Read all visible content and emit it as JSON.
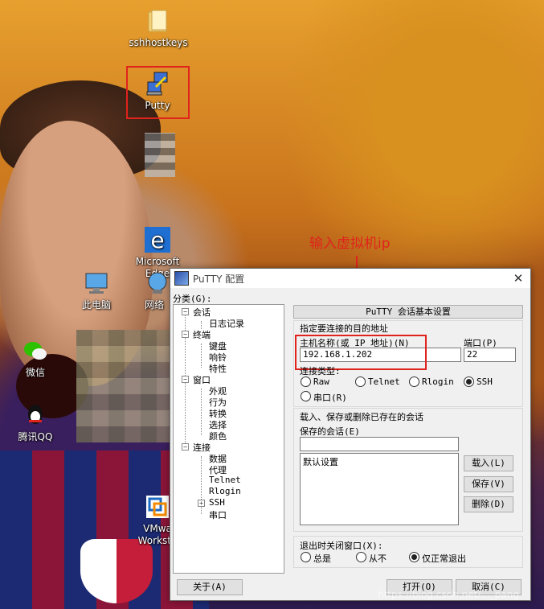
{
  "desktop": {
    "icons": [
      {
        "label": "sshhostkeys",
        "icon": "folder-icon"
      },
      {
        "label": "Putty",
        "icon": "putty-icon"
      },
      {
        "label": "Microsoft\nEdge",
        "icon": "edge-icon"
      },
      {
        "label": "此电脑",
        "icon": "computer-icon"
      },
      {
        "label": "网络",
        "icon": "network-icon"
      },
      {
        "label": "微信",
        "icon": "wechat-icon"
      },
      {
        "label": "腾讯QQ",
        "icon": "qq-icon"
      },
      {
        "label": "VMwa\nWorksta",
        "icon": "vmware-icon"
      }
    ],
    "annotation": "输入虚拟机ip",
    "watermark": "https://blog.csdn.net/..._pang"
  },
  "dialog": {
    "title": "PuTTY 配置",
    "close_glyph": "✕",
    "category_label": "分类(G):",
    "tree": {
      "session": "会话",
      "logging": "日志记录",
      "terminal": "终端",
      "keyboard": "键盘",
      "bell": "响铃",
      "features": "特性",
      "window": "窗口",
      "appearance": "外观",
      "behaviour": "行为",
      "translation": "转换",
      "selection": "选择",
      "colours": "颜色",
      "connection": "连接",
      "data": "数据",
      "proxy": "代理",
      "telnet": "Telnet",
      "rlogin": "Rlogin",
      "ssh": "SSH",
      "serial": "串口"
    },
    "header_button": "PuTTY 会话基本设置",
    "target_label": "指定要连接的目的地址",
    "host_label": "主机名称(或 IP 地址)(N)",
    "host_value": "192.168.1.202",
    "port_label": "端口(P)",
    "port_value": "22",
    "conn_type_label": "连接类型:",
    "conn_types": [
      "Raw",
      "Telnet",
      "Rlogin",
      "SSH",
      "串口(R)"
    ],
    "conn_selected": "SSH",
    "sessions_group_label": "载入、保存或删除已存在的会话",
    "saved_sessions_label": "保存的会话(E)",
    "saved_sessions_value": "",
    "session_list": [
      "默认设置"
    ],
    "load_button": "载入(L)",
    "save_button": "保存(V)",
    "delete_button": "删除(D)",
    "close_on_exit_label": "退出时关闭窗口(X):",
    "close_options": [
      "总是",
      "从不",
      "仅正常退出"
    ],
    "close_selected": "仅正常退出",
    "about_button": "关于(A)",
    "open_button": "打开(O)",
    "cancel_button": "取消(C)"
  },
  "colors": {
    "annotation": "#e0231c"
  }
}
